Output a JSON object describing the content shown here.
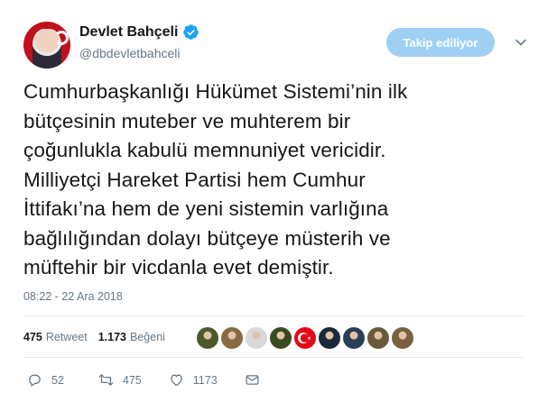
{
  "user": {
    "display_name": "Devlet Bahçeli",
    "handle": "@dbdevletbahceli",
    "verified": true,
    "avatar_icon": "profile-photo-with-crescent"
  },
  "follow_button": {
    "label": "Takip ediliyor"
  },
  "more_icon": "chevron-down-icon",
  "tweet": {
    "lines": [
      "Cumhurbaşkanlığı Hükümet Sistemi’nin ilk",
      "bütçesinin muteber ve muhterem bir",
      "çoğunlukla kabulü memnuniyet vericidir.",
      "Milliyetçi Hareket Partisi hem Cumhur",
      "İttifakı’na hem de yeni sistemin varlığına",
      "bağlılığından dolayı bütçeye müsterih ve",
      "müftehir bir vicdanla evet demiştir."
    ],
    "timestamp": "08:22 - 22 Ara 2018"
  },
  "stats": {
    "retweets_count": "475",
    "retweets_label": "Retweet",
    "likes_count": "1.173",
    "likes_label": "Beğeni"
  },
  "likers": [
    {
      "name": "liker-avatar-1",
      "color": "#4a5a2a"
    },
    {
      "name": "liker-avatar-2",
      "color": "#8a6a40"
    },
    {
      "name": "liker-avatar-3",
      "color": "#d8d8dc"
    },
    {
      "name": "liker-avatar-4",
      "color": "#3a4a20"
    },
    {
      "name": "liker-avatar-5",
      "color": "#e30a17"
    },
    {
      "name": "liker-avatar-6",
      "color": "#1a2a3a"
    },
    {
      "name": "liker-avatar-7",
      "color": "#2a3e5a"
    },
    {
      "name": "liker-avatar-8",
      "color": "#6a5a3a"
    },
    {
      "name": "liker-avatar-9",
      "color": "#7a6040"
    }
  ],
  "actions": {
    "reply_count": "52",
    "retweet_count": "475",
    "like_count": "1173"
  },
  "colors": {
    "accent": "#1da1f2",
    "follow_button_bg": "#9fd0f4",
    "secondary_text": "#657786"
  }
}
